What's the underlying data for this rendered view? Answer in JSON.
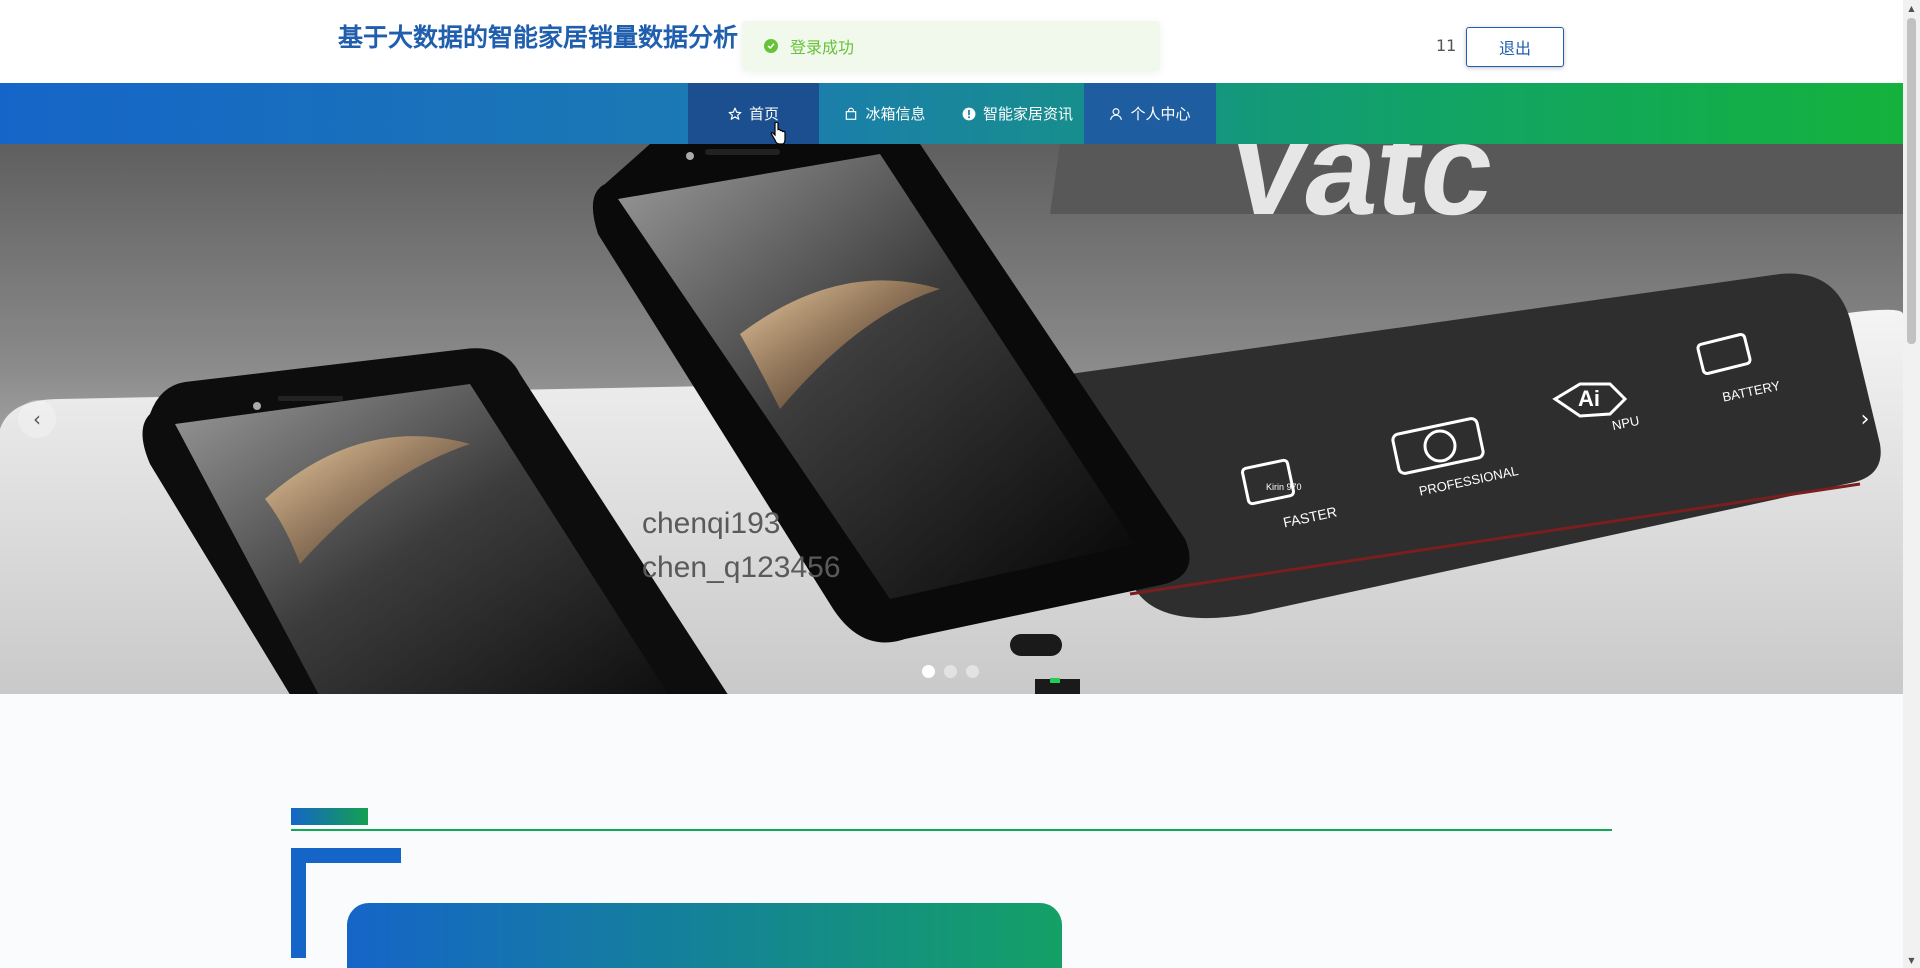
{
  "header": {
    "title": "基于大数据的智能家居销量数据分析",
    "username": "11",
    "logout_label": "退出"
  },
  "toast": {
    "icon": "check-circle-icon",
    "message": "登录成功",
    "color": "#67c23a"
  },
  "nav": {
    "items": [
      {
        "label": "首页",
        "icon": "star-icon",
        "active": true
      },
      {
        "label": "冰箱信息",
        "icon": "bag-icon"
      },
      {
        "label": "智能家居资讯",
        "icon": "info-icon"
      },
      {
        "label": "个人中心",
        "icon": "user-icon"
      }
    ]
  },
  "banner": {
    "overlay_lines": [
      "chenqi193",
      "chen_q123456"
    ],
    "feature_labels": [
      "FASTER",
      "PROFESSIONAL",
      "NPU",
      "BATTERY"
    ],
    "chip_text": "Kirin 970",
    "npu_text": "Ai",
    "dots_count": 3,
    "active_dot": 1,
    "prev_icon": "chevron-left-icon",
    "next_icon": "chevron-right-icon"
  },
  "colors": {
    "brand_blue": "#1565c8",
    "brand_green": "#14b23c",
    "title_blue": "#1f5fae",
    "nav_active": "#1b4f8f"
  }
}
